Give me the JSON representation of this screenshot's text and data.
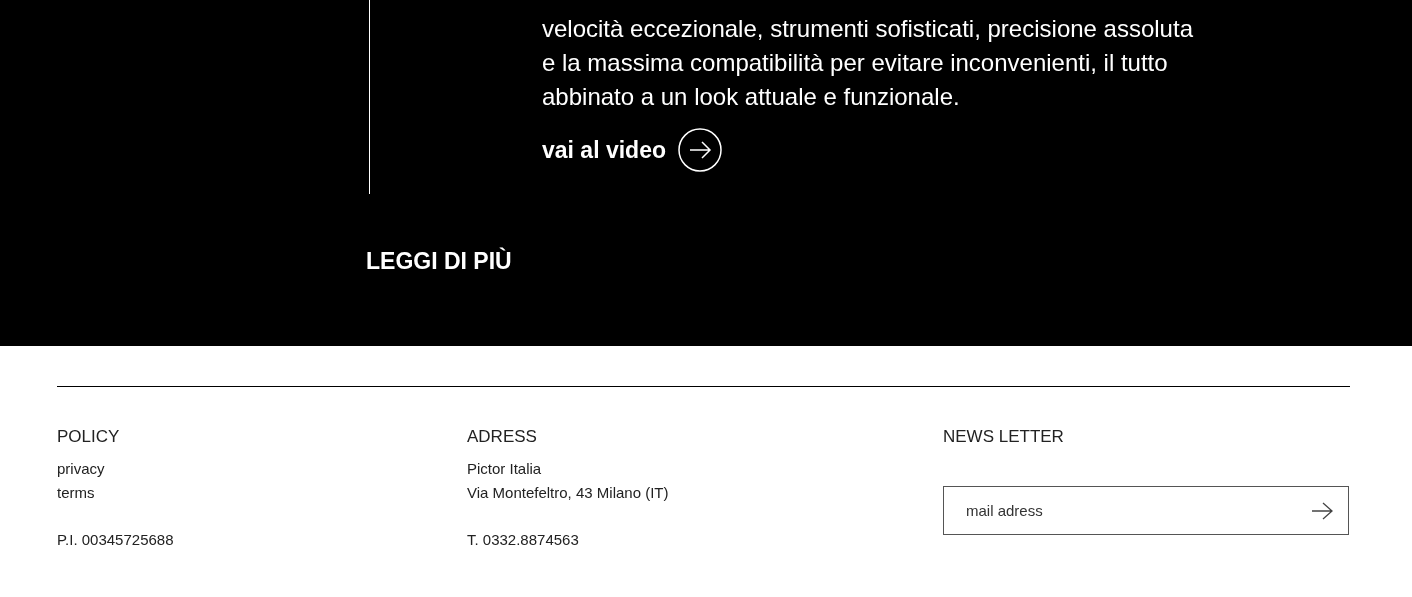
{
  "hero": {
    "paragraph_lines": [
      "velocità eccezionale, strumenti sofisticati, precisione assoluta",
      "e la massima compatibilità per evitare inconvenienti, il tutto",
      "abbinato a un look attuale e funzionale."
    ],
    "video_link": "vai al video",
    "read_more": "LEGGI DI PIÙ"
  },
  "footer": {
    "columns": [
      {
        "heading": "POLICY",
        "lines": [
          "privacy",
          "terms"
        ],
        "extra": "P.I. 00345725688"
      },
      {
        "heading": "ADRESS",
        "lines": [
          "Pictor Italia",
          "Via Montefeltro, 43 Milano (IT)"
        ],
        "extra": "T. 0332.8874563"
      }
    ],
    "newsletter": {
      "heading": "NEWS LETTER",
      "placeholder": "mail adress"
    }
  }
}
